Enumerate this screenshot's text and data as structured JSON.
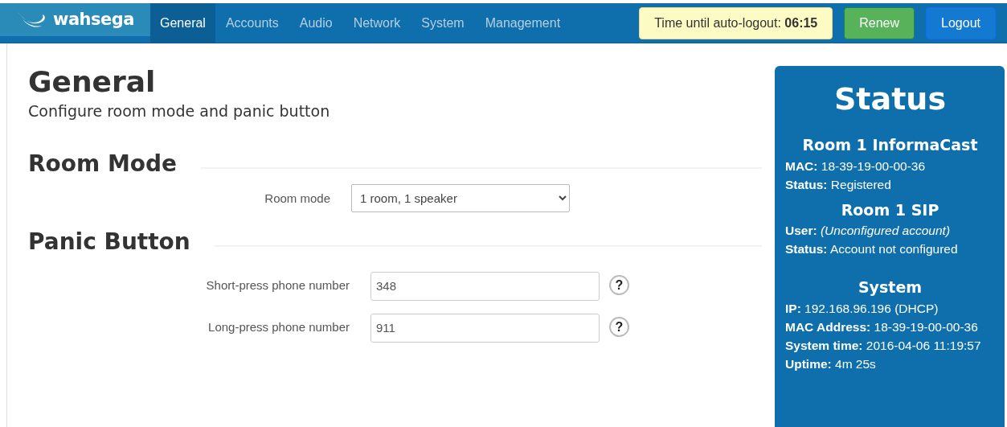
{
  "navbar": {
    "brand": "wahsega",
    "tabs": [
      {
        "label": "General",
        "selected": true
      },
      {
        "label": "Accounts",
        "selected": false
      },
      {
        "label": "Audio",
        "selected": false
      },
      {
        "label": "Network",
        "selected": false
      },
      {
        "label": "System",
        "selected": false
      },
      {
        "label": "Management",
        "selected": false
      }
    ],
    "timer": "Time until auto-logout: **06:15**",
    "buttons": [
      {
        "label": "Renew",
        "kind": "success"
      },
      {
        "label": "Logout",
        "kind": "primary"
      }
    ]
  },
  "page": {
    "title": "General",
    "subtitle": "Configure room mode and panic button",
    "sections": [
      {
        "heading": "Room Mode",
        "fields": [
          {
            "kind": "select",
            "label": "Room mode",
            "value": "1 room, 1 speaker"
          }
        ]
      },
      {
        "heading": "Panic Button",
        "fields": [
          {
            "kind": "text",
            "label": "Short-press phone number",
            "value": "348",
            "help": "?"
          },
          {
            "kind": "text",
            "label": "Long-press phone number",
            "value": "911",
            "help": "?"
          }
        ]
      }
    ]
  },
  "status": {
    "title": "Status",
    "groups": [
      {
        "heading": "Room 1 InformaCast",
        "lines": [
          "**MAC:** 18-39-19-00-00-36",
          "**Status:** Registered"
        ]
      },
      {
        "heading": "Room 1 SIP",
        "lines": [
          "**User:** *(Unconfigured account)*",
          "**Status:** Account not configured"
        ]
      },
      {
        "heading": "System",
        "lines": [
          "**IP:** 192.168.96.196 (DHCP)",
          "**MAC Address:** 18-39-19-00-00-36",
          "**System time:** 2016-04-06 11:19:57",
          "**Uptime:** 4m 25s"
        ]
      }
    ]
  }
}
